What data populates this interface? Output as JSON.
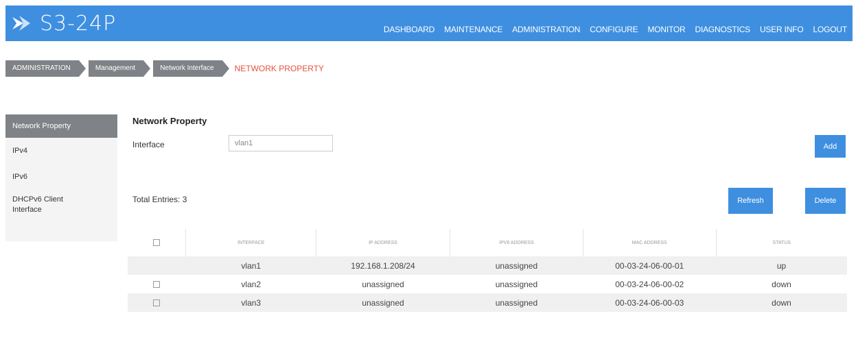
{
  "app": {
    "title": "S3-24P"
  },
  "nav": [
    "DASHBOARD",
    "MAINTENANCE",
    "ADMINISTRATION",
    "CONFIGURE",
    "MONITOR",
    "DIAGNOSTICS",
    "USER INFO",
    "LOGOUT"
  ],
  "breadcrumb": {
    "items": [
      "ADMINISTRATION",
      "Management",
      "Network Interface"
    ],
    "current": "NETWORK PROPERTY"
  },
  "sidebar": {
    "items": [
      {
        "label": "Network Property"
      },
      {
        "label": "IPv4"
      },
      {
        "label": "IPv6"
      },
      {
        "label": "DHCPv6 Client Interface"
      }
    ]
  },
  "main": {
    "title": "Network Property",
    "interface_label": "Interface",
    "interface_value": "vlan1",
    "add_label": "Add",
    "total_entries": "Total Entries: 3",
    "refresh_label": "Refresh",
    "delete_label": "Delete"
  },
  "table": {
    "headers": [
      "INTERFACE",
      "IP ADDRESS",
      "IPV6 ADDRESS",
      "MAC ADDRESS",
      "STATUS"
    ],
    "rows": [
      {
        "has_checkbox": false,
        "cells": [
          "vlan1",
          "192.168.1.208/24",
          "unassigned",
          "00-03-24-06-00-01",
          "up"
        ]
      },
      {
        "has_checkbox": true,
        "cells": [
          "vlan2",
          "unassigned",
          "unassigned",
          "00-03-24-06-00-02",
          "down"
        ]
      },
      {
        "has_checkbox": true,
        "cells": [
          "vlan3",
          "unassigned",
          "unassigned",
          "00-03-24-06-00-03",
          "down"
        ]
      }
    ]
  },
  "colors": {
    "accent": "#3f8fe0",
    "breadcrumb_bg": "#7f8287",
    "breadcrumb_current": "#e8513d"
  }
}
